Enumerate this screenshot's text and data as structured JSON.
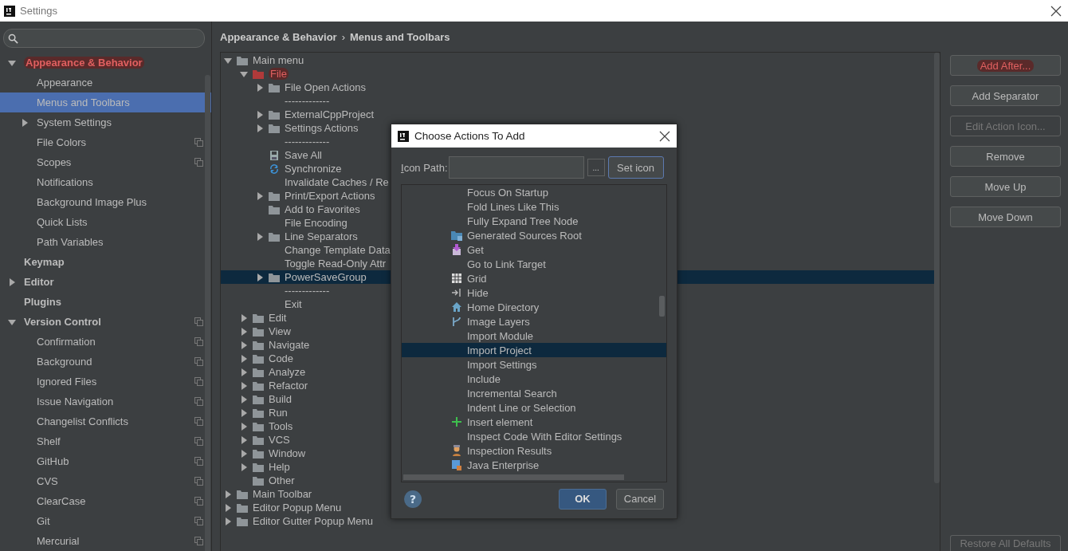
{
  "window": {
    "title": "Settings"
  },
  "sidebar": {
    "items": [
      {
        "label": "Appearance & Behavior",
        "expanded": true,
        "highlighted": true,
        "children": [
          {
            "label": "Appearance",
            "selected": false
          },
          {
            "label": "Menus and Toolbars",
            "selected": true
          },
          {
            "label": "System Settings",
            "selected": false,
            "expanded": false
          },
          {
            "label": "File Colors",
            "selected": false,
            "project": true
          },
          {
            "label": "Scopes",
            "selected": false,
            "project": true
          },
          {
            "label": "Notifications",
            "selected": false
          },
          {
            "label": "Background Image Plus",
            "selected": false
          },
          {
            "label": "Quick Lists",
            "selected": false
          },
          {
            "label": "Path Variables",
            "selected": false
          }
        ]
      },
      {
        "label": "Keymap"
      },
      {
        "label": "Editor",
        "expanded": false
      },
      {
        "label": "Plugins"
      },
      {
        "label": "Version Control",
        "expanded": true,
        "project": true,
        "children": [
          {
            "label": "Confirmation",
            "selected": false,
            "project": true
          },
          {
            "label": "Background",
            "selected": false,
            "project": true
          },
          {
            "label": "Ignored Files",
            "selected": false,
            "project": true
          },
          {
            "label": "Issue Navigation",
            "selected": false,
            "project": true
          },
          {
            "label": "Changelist Conflicts",
            "selected": false,
            "project": true
          },
          {
            "label": "Shelf",
            "selected": false,
            "project": true
          },
          {
            "label": "GitHub",
            "selected": false,
            "project": true
          },
          {
            "label": "CVS",
            "selected": false,
            "project": true
          },
          {
            "label": "ClearCase",
            "selected": false,
            "project": true
          },
          {
            "label": "Git",
            "selected": false,
            "project": true
          },
          {
            "label": "Mercurial",
            "selected": false,
            "project": true
          }
        ]
      }
    ]
  },
  "breadcrumb": [
    "Appearance & Behavior",
    "Menus and Toolbars"
  ],
  "breadcrumb_separator": "›",
  "tree": [
    {
      "label": "Main menu",
      "kind": "folder",
      "expanded": true,
      "selected": false,
      "children": [
        {
          "label": "File",
          "kind": "folder",
          "expanded": true,
          "highlighted": true,
          "selected": false,
          "children": [
            {
              "label": "File Open Actions",
              "kind": "folder",
              "expanded": false,
              "selected": false
            },
            {
              "label": "-------------",
              "selected": false
            },
            {
              "label": "ExternalCppProject",
              "kind": "folder",
              "expanded": false,
              "selected": false
            },
            {
              "label": "Settings Actions",
              "kind": "folder",
              "expanded": false,
              "selected": false
            },
            {
              "label": "-------------",
              "selected": false
            },
            {
              "label": "Save All",
              "kind": "save",
              "selected": false
            },
            {
              "label": "Synchronize",
              "kind": "sync",
              "selected": false
            },
            {
              "label": "Invalidate Caches / Re",
              "selected": false
            },
            {
              "label": "Print/Export Actions",
              "kind": "folder",
              "expanded": false,
              "selected": false
            },
            {
              "label": "Add to Favorites",
              "kind": "folder",
              "selected": false
            },
            {
              "label": "File Encoding",
              "selected": false
            },
            {
              "label": "Line Separators",
              "kind": "folder",
              "expanded": false,
              "selected": false
            },
            {
              "label": "Change Template Data",
              "selected": false
            },
            {
              "label": "Toggle Read-Only Attr",
              "selected": false
            },
            {
              "label": "PowerSaveGroup",
              "kind": "folder",
              "expanded": false,
              "selected": true
            },
            {
              "label": "-------------",
              "selected": false
            },
            {
              "label": "Exit",
              "selected": false
            }
          ]
        },
        {
          "label": "Edit",
          "kind": "folder",
          "expanded": false,
          "selected": false
        },
        {
          "label": "View",
          "kind": "folder",
          "expanded": false,
          "selected": false
        },
        {
          "label": "Navigate",
          "kind": "folder",
          "expanded": false,
          "selected": false
        },
        {
          "label": "Code",
          "kind": "folder",
          "expanded": false,
          "selected": false
        },
        {
          "label": "Analyze",
          "kind": "folder",
          "expanded": false,
          "selected": false
        },
        {
          "label": "Refactor",
          "kind": "folder",
          "expanded": false,
          "selected": false
        },
        {
          "label": "Build",
          "kind": "folder",
          "expanded": false,
          "selected": false
        },
        {
          "label": "Run",
          "kind": "folder",
          "expanded": false,
          "selected": false
        },
        {
          "label": "Tools",
          "kind": "folder",
          "expanded": false,
          "selected": false
        },
        {
          "label": "VCS",
          "kind": "folder",
          "expanded": false,
          "selected": false
        },
        {
          "label": "Window",
          "kind": "folder",
          "expanded": false,
          "selected": false
        },
        {
          "label": "Help",
          "kind": "folder",
          "expanded": false,
          "selected": false
        },
        {
          "label": "Other",
          "kind": "folder",
          "selected": false
        }
      ]
    },
    {
      "label": "Main Toolbar",
      "kind": "folder",
      "expanded": false,
      "selected": false
    },
    {
      "label": "Editor Popup Menu",
      "kind": "folder",
      "expanded": false,
      "selected": false
    },
    {
      "label": "Editor Gutter Popup Menu",
      "kind": "folder",
      "expanded": false,
      "selected": false
    }
  ],
  "buttons": [
    {
      "label": "Add After...",
      "highlighted": true,
      "disabled": false
    },
    {
      "label": "Add Separator",
      "disabled": false
    },
    {
      "label": "Edit Action Icon...",
      "disabled": true
    },
    {
      "label": "Remove",
      "disabled": false
    },
    {
      "label": "Move Up",
      "disabled": false
    },
    {
      "label": "Move Down",
      "disabled": false
    }
  ],
  "restore_button": {
    "label": "Restore All Defaults",
    "disabled": true
  },
  "dialog": {
    "title": "Choose Actions To Add",
    "icon_path": {
      "label": "Icon Path:"
    },
    "help_button": "?",
    "browse_button": "...",
    "set_icon_button": "Set icon",
    "actions": [
      {
        "label": "Focus On Startup",
        "selected": false
      },
      {
        "label": "Fold Lines Like This",
        "selected": false
      },
      {
        "label": "Fully Expand Tree Node",
        "selected": false
      },
      {
        "label": "Generated Sources Root",
        "kind": "source-folder",
        "selected": false
      },
      {
        "label": "Get",
        "kind": "download",
        "selected": false
      },
      {
        "label": "Go to Link Target",
        "selected": false
      },
      {
        "label": "Grid",
        "kind": "grid",
        "selected": false
      },
      {
        "label": "Hide",
        "kind": "hide",
        "selected": false
      },
      {
        "label": "Home Directory",
        "kind": "home",
        "selected": false
      },
      {
        "label": "Image Layers",
        "kind": "branch",
        "selected": false
      },
      {
        "label": "Import Module",
        "selected": false
      },
      {
        "label": "Import Project",
        "selected": true
      },
      {
        "label": "Import Settings",
        "selected": false
      },
      {
        "label": "Include",
        "selected": false
      },
      {
        "label": "Incremental Search",
        "selected": false
      },
      {
        "label": "Indent Line or Selection",
        "selected": false
      },
      {
        "label": "Insert element",
        "kind": "plus",
        "selected": false
      },
      {
        "label": "Inspect Code With Editor Settings",
        "selected": false
      },
      {
        "label": "Inspection Results",
        "kind": "figure",
        "selected": false
      },
      {
        "label": "Java Enterprise",
        "kind": "module",
        "selected": false
      }
    ],
    "ok_button": "OK",
    "cancel_button": "Cancel"
  }
}
